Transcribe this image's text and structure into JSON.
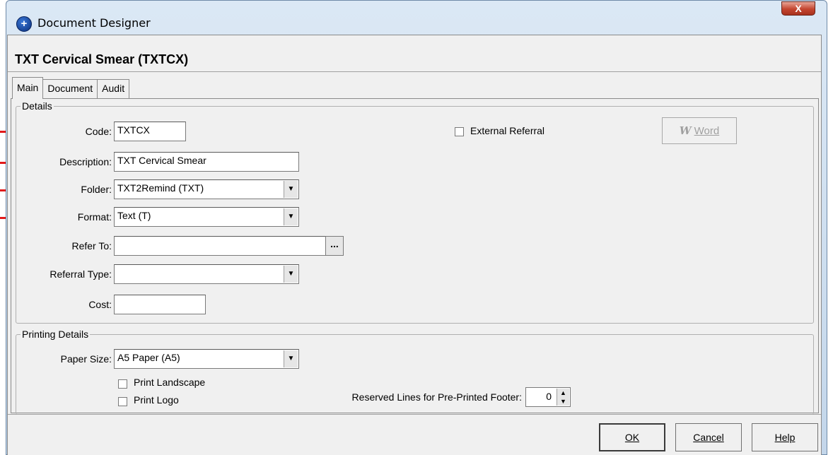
{
  "window": {
    "title": "Document Designer",
    "close_label": "X"
  },
  "document": {
    "title": "TXT Cervical Smear (TXTCX)"
  },
  "tabs": [
    {
      "label": "Main",
      "active": true
    },
    {
      "label": "Document",
      "active": false
    },
    {
      "label": "Audit",
      "active": false
    }
  ],
  "details": {
    "group_label": "Details",
    "code": {
      "label": "Code:",
      "value": "TXTCX"
    },
    "description": {
      "label": "Description:",
      "value": "TXT Cervical Smear"
    },
    "folder": {
      "label": "Folder:",
      "value": "TXT2Remind (TXT)"
    },
    "format": {
      "label": "Format:",
      "value": "Text (T)"
    },
    "refer_to": {
      "label": "Refer To:",
      "value": "",
      "button": "..."
    },
    "referral_type": {
      "label": "Referral Type:",
      "value": ""
    },
    "cost": {
      "label": "Cost:",
      "value": ""
    },
    "external_referral": {
      "label": "External Referral",
      "checked": false
    },
    "word_button": {
      "icon": "W",
      "label": "Word"
    }
  },
  "printing": {
    "group_label": "Printing Details",
    "paper_size": {
      "label": "Paper Size:",
      "value": "A5 Paper (A5)"
    },
    "print_landscape": {
      "label": "Print Landscape",
      "checked": false
    },
    "print_logo": {
      "label": "Print Logo",
      "checked": false
    },
    "reserved_lines": {
      "label": "Reserved Lines for Pre-Printed Footer:",
      "value": "0"
    }
  },
  "buttons": {
    "ok": "OK",
    "cancel": "Cancel",
    "help": "Help"
  },
  "colors": {
    "annotation_arrow": "#e21a1a"
  },
  "icons": {
    "app": "plus-circle-icon",
    "close": "close-icon",
    "dropdown": "chevron-down-icon",
    "word": "word-icon",
    "spin": "spin-updown-icon"
  }
}
